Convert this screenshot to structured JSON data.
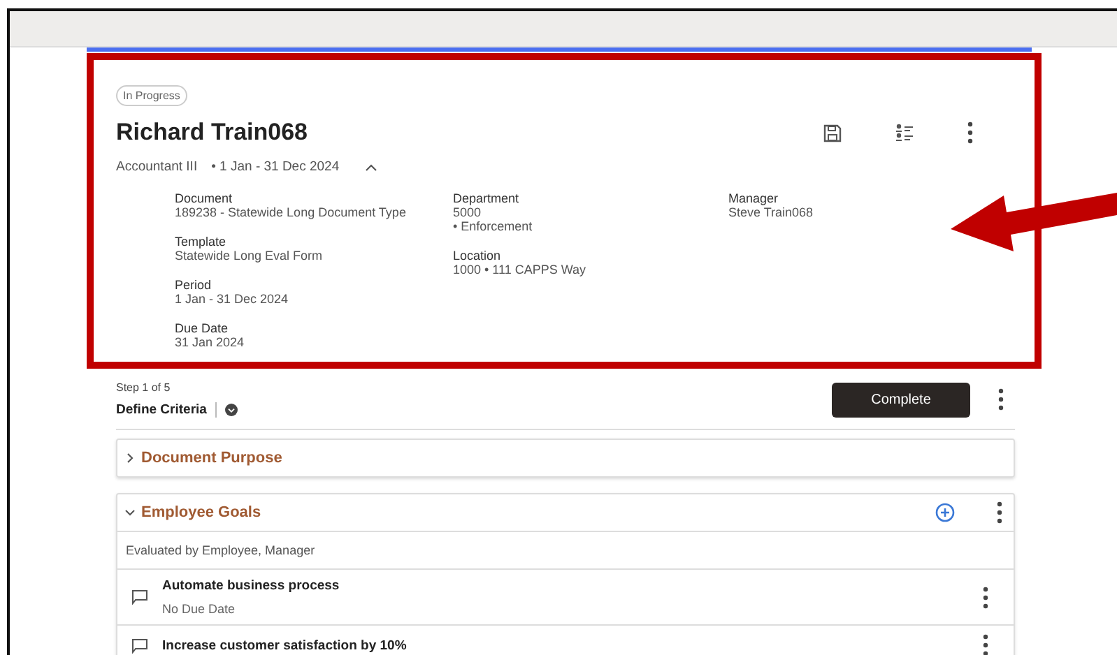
{
  "status_badge": "In Progress",
  "employee": {
    "name": "Richard Train068",
    "job": "Accountant III",
    "period": "• 1 Jan - 31 Dec 2024",
    "expanded": true
  },
  "details": [
    [
      {
        "label": "Document",
        "lines": [
          "189238 - Statewide Long Document Type"
        ]
      },
      {
        "label": "Template",
        "lines": [
          "Statewide Long Eval Form"
        ]
      },
      {
        "label": "Period",
        "lines": [
          "1 Jan - 31 Dec 2024"
        ]
      },
      {
        "label": "Due Date",
        "lines": [
          "31 Jan 2024"
        ]
      }
    ],
    [
      {
        "label": "Department",
        "lines": [
          "5000",
          "• Enforcement"
        ]
      },
      {
        "label": "Location",
        "lines": [
          "1000 •  111 CAPPS Way"
        ]
      }
    ],
    [
      {
        "label": "Manager",
        "lines": [
          "Steve Train068"
        ]
      }
    ]
  ],
  "step": {
    "counter": "Step 1 of 5",
    "name": "Define Criteria"
  },
  "complete_button": "Complete",
  "sections": [
    {
      "title": "Document Purpose",
      "expanded": false
    },
    {
      "title": "Employee Goals",
      "expanded": true,
      "evaluated_by": "Evaluated by Employee, Manager",
      "goals": [
        {
          "title": "Automate business process",
          "due": "No Due Date"
        },
        {
          "title": "Increase customer satisfaction by 10%"
        }
      ]
    }
  ]
}
